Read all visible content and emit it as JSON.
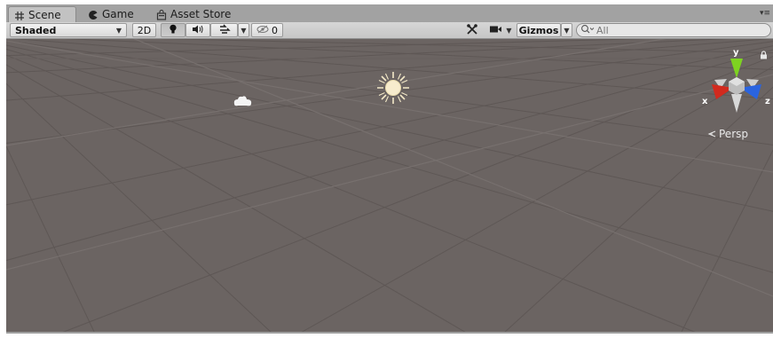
{
  "tabs": [
    {
      "label": "Scene",
      "icon": "grid-icon",
      "active": true
    },
    {
      "label": "Game",
      "icon": "pacman-icon",
      "active": false
    },
    {
      "label": "Asset Store",
      "icon": "shopping-bag-icon",
      "active": false
    }
  ],
  "toolbar": {
    "shading_mode": "Shaded",
    "mode_2d_label": "2D",
    "hidden_count": "0",
    "gizmos_label": "Gizmos",
    "search_placeholder": "All"
  },
  "viewport": {
    "projection_label": "Persp",
    "axis_labels": {
      "y": "y",
      "x": "x",
      "z": "z"
    },
    "background_color": "#6b6462",
    "axis_colors": {
      "x": "#d22a1e",
      "y": "#7ed321",
      "z": "#2a64e0"
    }
  }
}
